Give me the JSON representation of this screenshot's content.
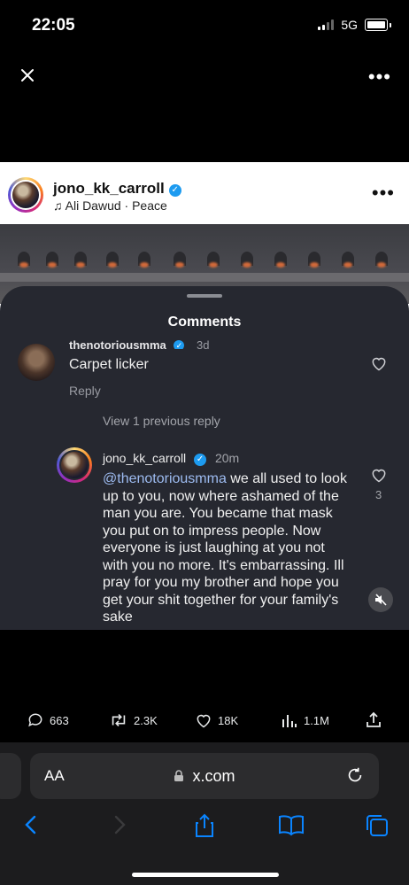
{
  "status": {
    "time": "22:05",
    "network": "5G"
  },
  "post": {
    "username": "jono_kk_carroll",
    "music": "Ali Dawud · Peace"
  },
  "comments": {
    "title": "Comments",
    "first": {
      "username": "thenotoriousmma",
      "time": "3d",
      "text": "Carpet licker",
      "reply_label": "Reply"
    },
    "view_previous": "View 1 previous reply",
    "reply": {
      "username": "jono_kk_carroll",
      "time": "20m",
      "mention": "@thenotoriousmma",
      "text": " we all used to look up to you, now where ashamed of the man you are. You became that mask you put on to impress people. Now everyone is just laughing at you not with you no more. It's embarrassing. Ill pray for you my brother and hope you get your shit together for your family's sake",
      "likes": "3"
    }
  },
  "tweet_actions": {
    "replies": "663",
    "retweets": "2.3K",
    "likes": "18K",
    "views": "1.1M"
  },
  "safari": {
    "aa_label": "AA",
    "url": "x.com"
  },
  "colors": {
    "accent": "#0a84ff",
    "verified": "#1d9bf0",
    "sheet": "#262830"
  }
}
